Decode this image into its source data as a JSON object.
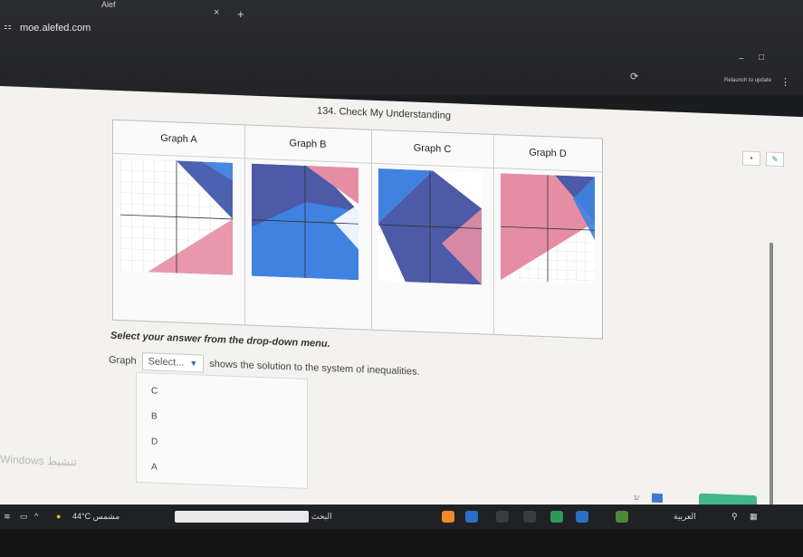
{
  "browser": {
    "tab_title": "Alef",
    "tab_close": "×",
    "tab_new": "+",
    "url": "moe.alefed.com",
    "update_text": "Relaunch to update",
    "menu_dots": "⋮",
    "min_icon": "−",
    "max_icon": "□",
    "reload_icon": "⟳",
    "site_icon": "⚏"
  },
  "question": {
    "title": "134. Check My Understanding",
    "graphs": [
      {
        "label": "Graph A"
      },
      {
        "label": "Graph B"
      },
      {
        "label": "Graph C"
      },
      {
        "label": "Graph D"
      }
    ],
    "instruction": "Select your answer from the drop-down menu.",
    "prefix": "Graph",
    "select_placeholder": "Select...",
    "suffix": "shows the solution to the system of inequalities.",
    "options": [
      "C",
      "B",
      "D",
      "A"
    ]
  },
  "tools": {
    "red_icon": "▪",
    "pen_icon": "✎"
  },
  "watermark": {
    "line1": "Windows تنشيط"
  },
  "footer": {
    "page_count": "1/"
  },
  "taskbar": {
    "weather": "44°C مشمس",
    "search_hint": "البحث",
    "language": "العربية"
  },
  "colors": {
    "pink": "#e58ea3",
    "blue": "#3f82e0",
    "navy": "#4d5aa8",
    "accent": "#2a6ec8",
    "next_green": "#45b58a"
  }
}
